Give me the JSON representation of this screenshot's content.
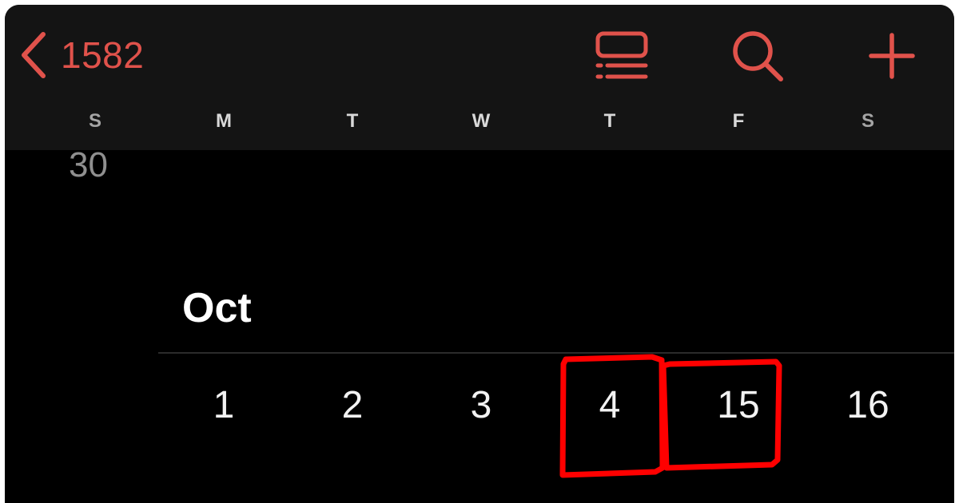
{
  "header": {
    "back_label": "1582",
    "icons": {
      "back": "chevron-left-icon",
      "list": "list-view-icon",
      "search": "search-icon",
      "add": "plus-icon"
    }
  },
  "weekdays": [
    "S",
    "M",
    "T",
    "W",
    "T",
    "F",
    "S"
  ],
  "previous_month": {
    "last_date": "30"
  },
  "month": {
    "label": "Oct",
    "dates": [
      "1",
      "2",
      "3",
      "4",
      "15",
      "16"
    ]
  },
  "colors": {
    "accent": "#e0524b",
    "annotation": "#ff0000",
    "header_bg": "#141414",
    "screen_bg": "#000000"
  }
}
